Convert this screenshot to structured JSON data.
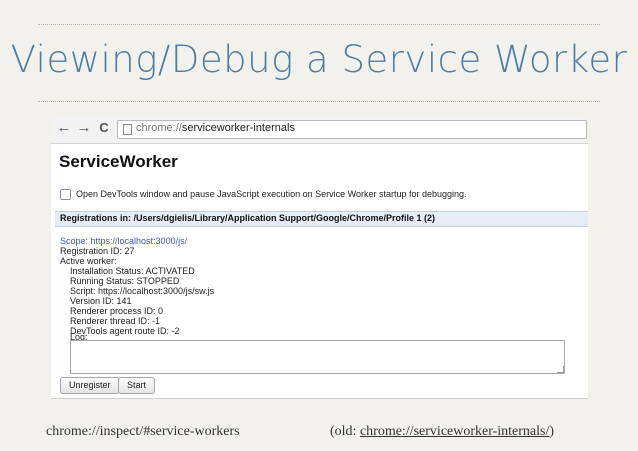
{
  "slide": {
    "title": "Viewing/Debug a Service Worker"
  },
  "browser": {
    "back_glyph": "←",
    "forward_glyph": "→",
    "reload_glyph": "C",
    "url_scheme": "chrome://",
    "url_path": "serviceworker-internals"
  },
  "page": {
    "heading": "ServiceWorker",
    "pause_checkbox_label": "Open DevTools window and pause JavaScript execution on Service Worker startup for debugging.",
    "registrations_heading": "Registrations in: /Users/dgielis/Library/Application Support/Google/Chrome/Profile 1 (2)",
    "registration": {
      "scope": "Scope: https://localhost:3000/js/",
      "registration_id": "Registration ID: 27",
      "active_worker": "Active worker:",
      "installation_status": "Installation Status: ACTIVATED",
      "running_status": "Running Status: STOPPED",
      "script": "Script: https://localhost:3000/js/sw.js",
      "version_id": "Version ID: 141",
      "renderer_process_id": "Renderer process ID: 0",
      "renderer_thread_id": "Renderer thread ID: -1",
      "devtools_route_id": "DevTools agent route ID: -2",
      "log_label": "Log:"
    },
    "log_value": "",
    "unregister_label": "Unregister",
    "start_label": "Start"
  },
  "footer": {
    "left": "chrome://inspect/#service-workers",
    "right_prefix": "(old: ",
    "right_link": "chrome://serviceworker-internals/",
    "right_suffix": ")"
  }
}
